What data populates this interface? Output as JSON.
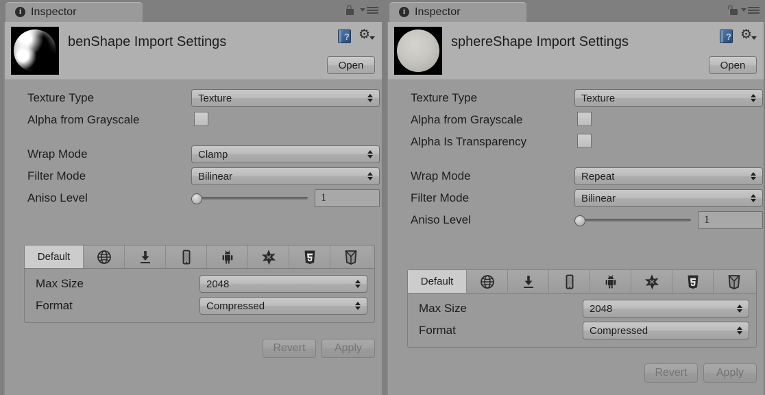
{
  "panels": [
    {
      "key": "left",
      "tab": {
        "label": "Inspector",
        "icon": "info-icon"
      },
      "window_icons": {
        "lock": "lock-icon",
        "menu": "menu-icon"
      },
      "asset": {
        "title": "benShape Import Settings",
        "thumbnail": "ben-shape-texture-preview",
        "help_icon": "help-book-icon",
        "gear_icon": "gear-icon",
        "open_label": "Open"
      },
      "properties": [
        {
          "type": "dropdown",
          "label": "Texture Type",
          "value": "Texture"
        },
        {
          "type": "checkbox",
          "label": "Alpha from Grayscale",
          "checked": false
        },
        {
          "type": "dropdown",
          "label": "Wrap Mode",
          "value": "Clamp"
        },
        {
          "type": "dropdown",
          "label": "Filter Mode",
          "value": "Bilinear"
        },
        {
          "type": "slider",
          "label": "Aniso Level",
          "value": "1",
          "percent": 0
        }
      ],
      "platform": {
        "tabs": [
          {
            "label": "Default",
            "icon": "default-tab",
            "selected": true
          },
          {
            "label": "",
            "icon": "web-globe-icon",
            "selected": false
          },
          {
            "label": "",
            "icon": "standalone-download-icon",
            "selected": false
          },
          {
            "label": "",
            "icon": "ios-phone-icon",
            "selected": false
          },
          {
            "label": "",
            "icon": "android-robot-icon",
            "selected": false
          },
          {
            "label": "",
            "icon": "flash-star-icon",
            "selected": false
          },
          {
            "label": "",
            "icon": "html5-shield-icon",
            "selected": false
          },
          {
            "label": "",
            "icon": "tizen-shield-icon",
            "selected": false
          }
        ],
        "settings": [
          {
            "type": "dropdown",
            "label": "Max Size",
            "value": "2048"
          },
          {
            "type": "dropdown",
            "label": "Format",
            "value": "Compressed"
          }
        ]
      },
      "footer": {
        "revert_label": "Revert",
        "apply_label": "Apply",
        "enabled": false
      }
    },
    {
      "key": "right",
      "tab": {
        "label": "Inspector",
        "icon": "info-icon"
      },
      "window_icons": {
        "lock": "lock-icon",
        "menu": "menu-icon"
      },
      "asset": {
        "title": "sphereShape Import Settings",
        "thumbnail": "sphere-shape-texture-preview",
        "help_icon": "help-book-icon",
        "gear_icon": "gear-icon",
        "open_label": "Open"
      },
      "properties": [
        {
          "type": "dropdown",
          "label": "Texture Type",
          "value": "Texture"
        },
        {
          "type": "checkbox",
          "label": "Alpha from Grayscale",
          "checked": false
        },
        {
          "type": "checkbox",
          "label": "Alpha Is Transparency",
          "checked": false
        },
        {
          "type": "dropdown",
          "label": "Wrap Mode",
          "value": "Repeat"
        },
        {
          "type": "dropdown",
          "label": "Filter Mode",
          "value": "Bilinear"
        },
        {
          "type": "slider",
          "label": "Aniso Level",
          "value": "1",
          "percent": 0
        }
      ],
      "platform": {
        "tabs": [
          {
            "label": "Default",
            "icon": "default-tab",
            "selected": true
          },
          {
            "label": "",
            "icon": "web-globe-icon",
            "selected": false
          },
          {
            "label": "",
            "icon": "standalone-download-icon",
            "selected": false
          },
          {
            "label": "",
            "icon": "ios-phone-icon",
            "selected": false
          },
          {
            "label": "",
            "icon": "android-robot-icon",
            "selected": false
          },
          {
            "label": "",
            "icon": "flash-star-icon",
            "selected": false
          },
          {
            "label": "",
            "icon": "html5-shield-icon",
            "selected": false
          },
          {
            "label": "",
            "icon": "tizen-shield-icon",
            "selected": false
          }
        ],
        "settings": [
          {
            "type": "dropdown",
            "label": "Max Size",
            "value": "2048"
          },
          {
            "type": "dropdown",
            "label": "Format",
            "value": "Compressed"
          }
        ]
      },
      "footer": {
        "revert_label": "Revert",
        "apply_label": "Apply",
        "enabled": false
      }
    }
  ],
  "colors": {
    "window_chrome": "#7f7f7f",
    "panel_bg": "#9a9a9a",
    "header_bg": "#b0b0b0",
    "selected_tab": "#cccccc",
    "text": "#1c1c1c",
    "disabled_text": "#737373",
    "help_book_blue": "#3c5f8c"
  }
}
